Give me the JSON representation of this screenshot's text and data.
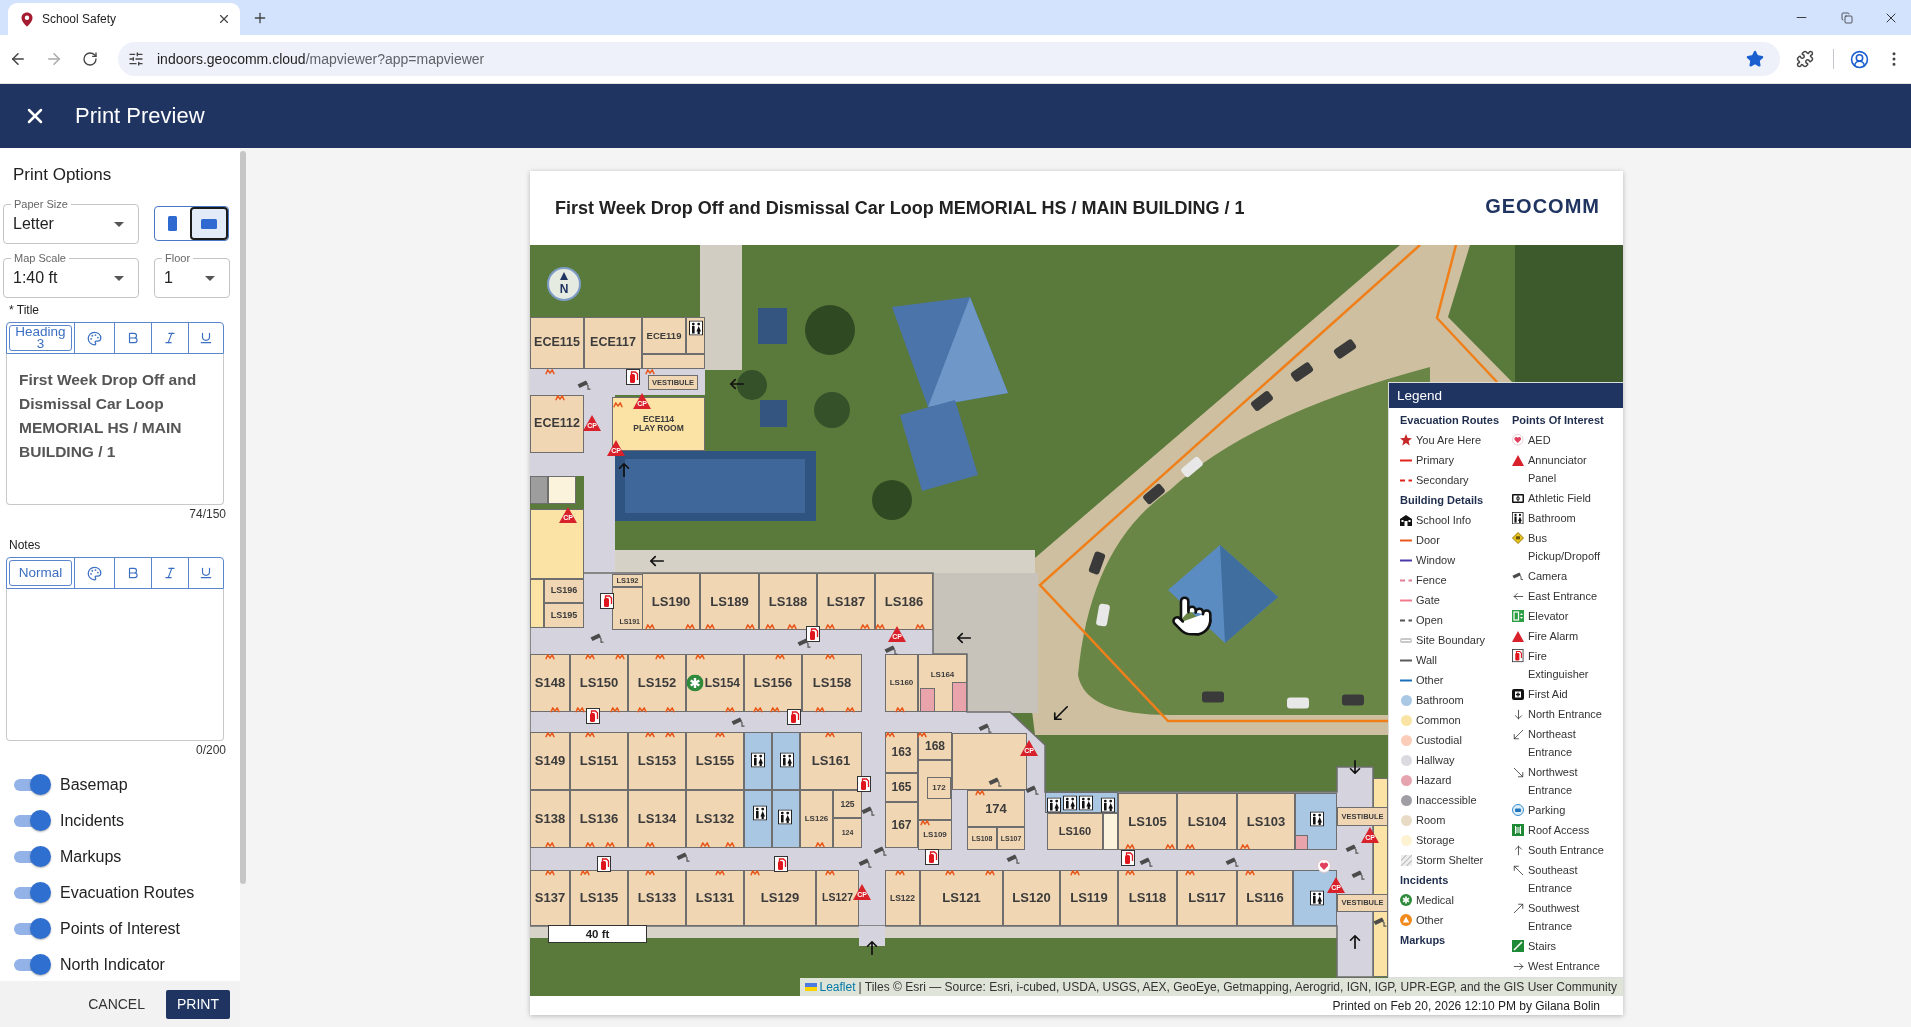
{
  "browser": {
    "tab_title": "School Safety",
    "url_host": "indoors.geocomm.cloud",
    "url_path": "/mapviewer?app=mapviewer",
    "bookmarked": true
  },
  "app_bar": {
    "title": "Print Preview"
  },
  "print_options": {
    "heading": "Print Options",
    "paper_size": {
      "label": "Paper Size",
      "value": "Letter"
    },
    "orientation": [
      {
        "kind": "portrait",
        "selected": false
      },
      {
        "kind": "landscape",
        "selected": true
      }
    ],
    "map_scale": {
      "label": "Map Scale",
      "value": "1:40 ft"
    },
    "floor": {
      "label": "Floor",
      "value": "1"
    },
    "title": {
      "label": "* Title",
      "style": "Heading 3",
      "value": "First Week Drop Off and Dismissal Car Loop MEMORIAL HS / MAIN BUILDING / 1",
      "counter": "74/150"
    },
    "notes": {
      "label": "Notes",
      "style": "Normal",
      "counter": "0/200"
    },
    "layers": [
      {
        "label": "Basemap",
        "on": true
      },
      {
        "label": "Incidents",
        "on": true
      },
      {
        "label": "Markups",
        "on": true
      },
      {
        "label": "Evacuation Routes",
        "on": true
      },
      {
        "label": "Points of Interest",
        "on": true
      },
      {
        "label": "North Indicator",
        "on": true
      }
    ],
    "cancel": "CANCEL",
    "print": "PRINT"
  },
  "preview": {
    "title": "First Week Drop Off and Dismissal Car Loop MEMORIAL HS / MAIN BUILDING / 1",
    "logo": "GEOCOMM",
    "map": {
      "north": "N",
      "scale": "40 ft",
      "rooms": [
        {
          "kind": "room",
          "label": "ECE115"
        },
        {
          "kind": "room",
          "label": "ECE117"
        },
        {
          "kind": "room",
          "label": "ECE119"
        },
        {
          "kind": "room"
        },
        {
          "kind": "room"
        },
        {
          "kind": "room",
          "label": "VESTIBULE"
        },
        {
          "kind": "room",
          "label": "ECE112"
        },
        {
          "kind": "common",
          "label": "ECE114",
          "name": "PLAY ROOM"
        },
        {
          "kind": "inaccessible"
        },
        {
          "kind": "storage"
        },
        {
          "kind": "common"
        },
        {
          "kind": "common"
        },
        {
          "kind": "room",
          "label": "LS196"
        },
        {
          "kind": "room",
          "label": "LS195"
        },
        {
          "kind": "room",
          "label": "LS192"
        },
        {
          "kind": "room",
          "label": "LS191"
        },
        {
          "kind": "room",
          "label": "LS190"
        },
        {
          "kind": "room",
          "label": "LS189"
        },
        {
          "kind": "room",
          "label": "LS188"
        },
        {
          "kind": "room",
          "label": "LS187"
        },
        {
          "kind": "room",
          "label": "LS186"
        },
        {
          "kind": "room",
          "label": "S148"
        },
        {
          "kind": "room",
          "label": "LS150"
        },
        {
          "kind": "room",
          "label": "LS152"
        },
        {
          "kind": "room",
          "label": "LS154"
        },
        {
          "kind": "room",
          "label": "LS156"
        },
        {
          "kind": "room",
          "label": "LS158"
        },
        {
          "kind": "room",
          "label": "LS160"
        },
        {
          "kind": "room",
          "label": "LS164"
        },
        {
          "kind": "hazard"
        },
        {
          "kind": "hazard"
        },
        {
          "kind": "room",
          "label": "S149"
        },
        {
          "kind": "room",
          "label": "LS151"
        },
        {
          "kind": "room",
          "label": "LS153"
        },
        {
          "kind": "room",
          "label": "LS155"
        },
        {
          "kind": "bathroom"
        },
        {
          "kind": "bathroom"
        },
        {
          "kind": "room",
          "label": "LS161"
        },
        {
          "kind": "room",
          "label": "163"
        },
        {
          "kind": "room",
          "label": "168"
        },
        {
          "kind": "room"
        },
        {
          "kind": "room",
          "label": "165"
        },
        {
          "kind": "room"
        },
        {
          "kind": "room",
          "label": "172"
        },
        {
          "kind": "room",
          "label": "S138"
        },
        {
          "kind": "room",
          "label": "LS136"
        },
        {
          "kind": "room",
          "label": "LS134"
        },
        {
          "kind": "room",
          "label": "LS132"
        },
        {
          "kind": "bathroom"
        },
        {
          "kind": "bathroom"
        },
        {
          "kind": "room",
          "label": "LS126"
        },
        {
          "kind": "room",
          "label": "125"
        },
        {
          "kind": "room",
          "label": "124"
        },
        {
          "kind": "room",
          "label": "167"
        },
        {
          "kind": "room",
          "label": "LS109"
        },
        {
          "kind": "room",
          "label": "174"
        },
        {
          "kind": "room",
          "label": "LS108"
        },
        {
          "kind": "room",
          "label": "LS107"
        },
        {
          "kind": "bathroom"
        },
        {
          "kind": "room",
          "label": "LS160"
        },
        {
          "kind": "storage"
        },
        {
          "kind": "room",
          "label": "LS105"
        },
        {
          "kind": "room",
          "label": "LS104"
        },
        {
          "kind": "room",
          "label": "LS103"
        },
        {
          "kind": "bathroom"
        },
        {
          "kind": "hazard"
        },
        {
          "kind": "common"
        },
        {
          "kind": "room",
          "label": "VESTIBULE"
        },
        {
          "kind": "room",
          "label": "S137"
        },
        {
          "kind": "room",
          "label": "LS135"
        },
        {
          "kind": "room",
          "label": "LS133"
        },
        {
          "kind": "room",
          "label": "LS131"
        },
        {
          "kind": "room",
          "label": "LS129"
        },
        {
          "kind": "room",
          "label": "LS127"
        },
        {
          "kind": "room",
          "label": "LS122"
        },
        {
          "kind": "room",
          "label": "LS121"
        },
        {
          "kind": "room",
          "label": "LS120"
        },
        {
          "kind": "room",
          "label": "LS119"
        },
        {
          "kind": "room",
          "label": "LS118"
        },
        {
          "kind": "room",
          "label": "LS117"
        },
        {
          "kind": "room",
          "label": "LS116"
        },
        {
          "kind": "bathroom"
        },
        {
          "kind": "room",
          "label": "VESTIBULE"
        }
      ],
      "markers": [
        {
          "kind": "restroom"
        },
        {
          "kind": "extinguisher"
        },
        {
          "kind": "camera"
        },
        {
          "kind": "arrow-left"
        },
        {
          "kind": "alarm",
          "label": "CP"
        },
        {
          "kind": "alarm",
          "label": "CP"
        },
        {
          "kind": "alarm",
          "label": "CP"
        },
        {
          "kind": "arrow-up"
        },
        {
          "kind": "alarm",
          "label": "CP"
        },
        {
          "kind": "arrow-left"
        },
        {
          "kind": "extinguisher"
        },
        {
          "kind": "extinguisher"
        },
        {
          "kind": "alarm",
          "label": "CP"
        },
        {
          "kind": "camera"
        },
        {
          "kind": "camera"
        },
        {
          "kind": "camera"
        },
        {
          "kind": "arrow-left"
        },
        {
          "kind": "medical"
        },
        {
          "kind": "arrow-down-left"
        },
        {
          "kind": "extinguisher"
        },
        {
          "kind": "extinguisher"
        },
        {
          "kind": "camera"
        },
        {
          "kind": "camera"
        },
        {
          "kind": "alarm",
          "label": "CP"
        },
        {
          "kind": "restroom"
        },
        {
          "kind": "restroom"
        },
        {
          "kind": "arrow-down"
        },
        {
          "kind": "camera"
        },
        {
          "kind": "extinguisher"
        },
        {
          "kind": "camera"
        },
        {
          "kind": "restroom"
        },
        {
          "kind": "restroom"
        },
        {
          "kind": "restroom"
        },
        {
          "kind": "restroom"
        },
        {
          "kind": "camera"
        },
        {
          "kind": "restroom"
        },
        {
          "kind": "restroom"
        },
        {
          "kind": "restroom"
        },
        {
          "kind": "alarm",
          "label": "CP"
        },
        {
          "kind": "camera"
        },
        {
          "kind": "camera"
        },
        {
          "kind": "extinguisher"
        },
        {
          "kind": "camera"
        },
        {
          "kind": "extinguisher"
        },
        {
          "kind": "camera"
        },
        {
          "kind": "camera"
        },
        {
          "kind": "camera"
        },
        {
          "kind": "camera"
        },
        {
          "kind": "extinguisher"
        },
        {
          "kind": "extinguisher"
        },
        {
          "kind": "aed"
        },
        {
          "kind": "camera"
        },
        {
          "kind": "alarm",
          "label": "CP"
        },
        {
          "kind": "alarm",
          "label": "CP"
        },
        {
          "kind": "restroom"
        },
        {
          "kind": "camera"
        },
        {
          "kind": "arrow-up"
        },
        {
          "kind": "arrow-up"
        }
      ]
    },
    "legend": {
      "title": "Legend",
      "columns": [
        {
          "groups": [
            {
              "heading": "Evacuation Routes",
              "items": [
                {
                  "label": "You Are Here",
                  "kind": "star",
                  "color": "#c62828"
                },
                {
                  "label": "Primary",
                  "kind": "line",
                  "color": "#e0241b"
                },
                {
                  "label": "Secondary",
                  "kind": "dashed",
                  "color": "#e0241b"
                }
              ]
            },
            {
              "heading": "Building Details",
              "items": [
                {
                  "label": "School Info",
                  "kind": "school"
                },
                {
                  "label": "Door",
                  "kind": "line",
                  "color": "#e8581c"
                },
                {
                  "label": "Window",
                  "kind": "line",
                  "color": "#4a3aa8"
                },
                {
                  "label": "Fence",
                  "kind": "dashed",
                  "color": "#e27d96"
                },
                {
                  "label": "Gate",
                  "kind": "line",
                  "color": "#f07a8c"
                },
                {
                  "label": "Open",
                  "kind": "dashed",
                  "color": "#555555"
                },
                {
                  "label": "Site Boundary",
                  "kind": "double",
                  "color": "#c8c8c8"
                },
                {
                  "label": "Wall",
                  "kind": "line",
                  "color": "#5a5a5a"
                },
                {
                  "label": "Other",
                  "kind": "line",
                  "color": "#1d6fb8"
                },
                {
                  "label": "Bathroom",
                  "kind": "circle",
                  "color": "#a8c8e4"
                },
                {
                  "label": "Common",
                  "kind": "circle",
                  "color": "#f9e4a4"
                },
                {
                  "label": "Custodial",
                  "kind": "circle",
                  "color": "#fbcdb8"
                },
                {
                  "label": "Hallway",
                  "kind": "circle",
                  "color": "#dadae0"
                },
                {
                  "label": "Hazard",
                  "kind": "circle",
                  "color": "#e5a4ae"
                },
                {
                  "label": "Inaccessible",
                  "kind": "circle",
                  "color": "#a09ea4"
                },
                {
                  "label": "Room",
                  "kind": "circle",
                  "color": "#e8dbc6"
                },
                {
                  "label": "Storage",
                  "kind": "circle",
                  "color": "#fdf3d2"
                },
                {
                  "label": "Storm Shelter",
                  "kind": "hatch"
                }
              ]
            },
            {
              "heading": "Incidents",
              "items": [
                {
                  "label": "Medical",
                  "kind": "medical"
                },
                {
                  "label": "Other",
                  "kind": "incident"
                }
              ]
            },
            {
              "heading": "Markups"
            }
          ]
        },
        {
          "groups": [
            {
              "heading": "Points Of Interest",
              "items": [
                {
                  "label": "AED",
                  "kind": "aed"
                },
                {
                  "label": "Annunciator Panel",
                  "kind": "alarm"
                },
                {
                  "label": "Athletic Field",
                  "kind": "field"
                },
                {
                  "label": "Bathroom",
                  "kind": "restroom"
                },
                {
                  "label": "Bus Pickup/Dropoff",
                  "kind": "bus"
                },
                {
                  "label": "Camera",
                  "kind": "camera"
                },
                {
                  "label": "East Entrance",
                  "kind": "arrow-left"
                },
                {
                  "label": "Elevator",
                  "kind": "elevator"
                },
                {
                  "label": "Fire Alarm",
                  "kind": "alarm"
                },
                {
                  "label": "Fire Extinguisher",
                  "kind": "extinguisher"
                },
                {
                  "label": "First Aid",
                  "kind": "firstaid"
                },
                {
                  "label": "North Entrance",
                  "kind": "arrow-down"
                },
                {
                  "label": "Northeast Entrance",
                  "kind": "arrow-down-left"
                },
                {
                  "label": "Northwest Entrance",
                  "kind": "arrow-down-right"
                },
                {
                  "label": "Parking",
                  "kind": "parking"
                },
                {
                  "label": "Roof Access",
                  "kind": "roof"
                },
                {
                  "label": "South Entrance",
                  "kind": "arrow-up"
                },
                {
                  "label": "Southeast Entrance",
                  "kind": "arrow-up-left"
                },
                {
                  "label": "Southwest Entrance",
                  "kind": "arrow-up-right"
                },
                {
                  "label": "Stairs",
                  "kind": "stairs"
                },
                {
                  "label": "West Entrance",
                  "kind": "arrow-right"
                }
              ]
            }
          ]
        }
      ]
    },
    "attribution": {
      "link": "Leaflet",
      "text": "| Tiles © Esri — Source: Esri, i-cubed, USDA, USGS, AEX, GeoEye, Getmapping, Aerogrid, IGN, IGP, UPR-EGP, and the GIS User Community"
    },
    "printed": "Printed on Feb 20, 2026 12:10 PM by Gilana Bolin"
  }
}
